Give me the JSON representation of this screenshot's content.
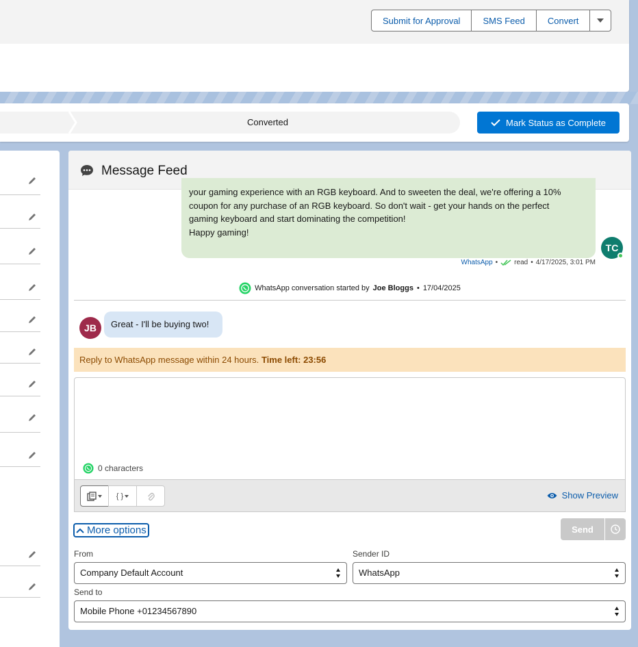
{
  "header": {
    "buttons": [
      "Submit for Approval",
      "SMS Feed",
      "Convert"
    ]
  },
  "path": {
    "current_step": "Converted",
    "mark_complete_label": "Mark Status as Complete"
  },
  "feed": {
    "title": "Message Feed",
    "outgoing_message": {
      "lines": [
        "your gaming experience with an RGB keyboard. And to sweeten the deal, we're offering a 10%",
        "coupon for any purchase of an RGB keyboard. So don't wait - get your hands on the perfect",
        "gaming keyboard and start dominating the competition!",
        "Happy gaming!"
      ],
      "channel": "WhatsApp",
      "status": "read",
      "timestamp": "4/17/2025, 3:01 PM",
      "avatar_initials": "TC"
    },
    "conversation_start": {
      "prefix": "WhatsApp conversation started by",
      "by": "Joe Bloggs",
      "date": "17/04/2025"
    },
    "incoming_message": {
      "text": "Great - I'll be buying two!",
      "avatar_initials": "JB"
    },
    "reply_timer": {
      "text": "Reply to WhatsApp message within 24 hours.",
      "time_left": "Time left: 23:56"
    },
    "compose": {
      "char_count": "0 characters",
      "show_preview": "Show Preview",
      "more_options": "More options",
      "send": "Send"
    },
    "fields": {
      "from_label": "From",
      "from_value": "Company Default Account",
      "sender_label": "Sender ID",
      "sender_value": "WhatsApp",
      "send_to_label": "Send to",
      "send_to_value": "Mobile Phone +01234567890"
    }
  },
  "colors": {
    "brand": "#0176d3",
    "link": "#0b5cab",
    "outgoing_bubble": "#dcebd4",
    "incoming_bubble": "#d8e6f5",
    "warning": "#fbe2bc"
  }
}
